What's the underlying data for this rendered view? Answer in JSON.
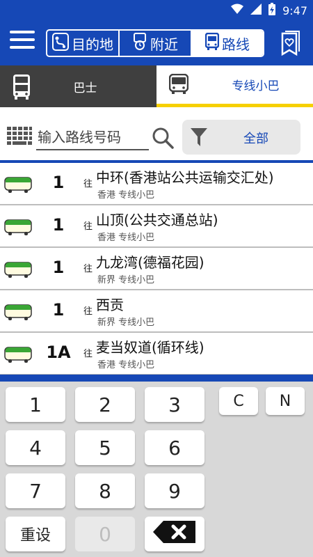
{
  "status_bar": {
    "time": "9:47",
    "icons": [
      "wifi-icon",
      "signal-icon",
      "battery-charging-icon"
    ]
  },
  "app_bar": {
    "menu_icon": "hamburger-icon",
    "segments": [
      {
        "label": "目的地",
        "icon": "route-pin-icon",
        "active": false
      },
      {
        "label": "附近",
        "icon": "nearby-stop-icon",
        "active": false
      },
      {
        "label": "路线",
        "icon": "bus-front-icon",
        "active": true
      }
    ],
    "bookmark_icon": "bookmark-heart-icon"
  },
  "transport_tabs": [
    {
      "label": "巴士",
      "icon": "double-decker-icon",
      "active": false
    },
    {
      "label": "专线小巴",
      "icon": "minibus-icon",
      "active": true
    }
  ],
  "search": {
    "placeholder": "输入路线号码",
    "value": "",
    "filter_label": "全部"
  },
  "routes": [
    {
      "number": "1",
      "to": "往",
      "destination": "中环(香港站公共运输交汇处)",
      "subtitle": "香港 专线小巴"
    },
    {
      "number": "1",
      "to": "往",
      "destination": "山顶(公共交通总站)",
      "subtitle": "香港 专线小巴"
    },
    {
      "number": "1",
      "to": "往",
      "destination": "九龙湾(德福花园)",
      "subtitle": "新界 专线小巴"
    },
    {
      "number": "1",
      "to": "往",
      "destination": "西贡",
      "subtitle": "新界 专线小巴"
    },
    {
      "number": "1A",
      "to": "往",
      "destination": "麦当奴道(循环线)",
      "subtitle": "香港 专线小巴"
    }
  ],
  "keypad": {
    "keys": [
      "1",
      "2",
      "3",
      "4",
      "5",
      "6",
      "7",
      "8",
      "9",
      "0"
    ],
    "letters": [
      "C",
      "N"
    ],
    "reset_label": "重设",
    "backspace_icon": "backspace-icon"
  },
  "colors": {
    "primary": "#1648b6",
    "accent": "#f6d000",
    "minibus_green": "#3aa635",
    "tab_dark": "#3f3f3f"
  }
}
